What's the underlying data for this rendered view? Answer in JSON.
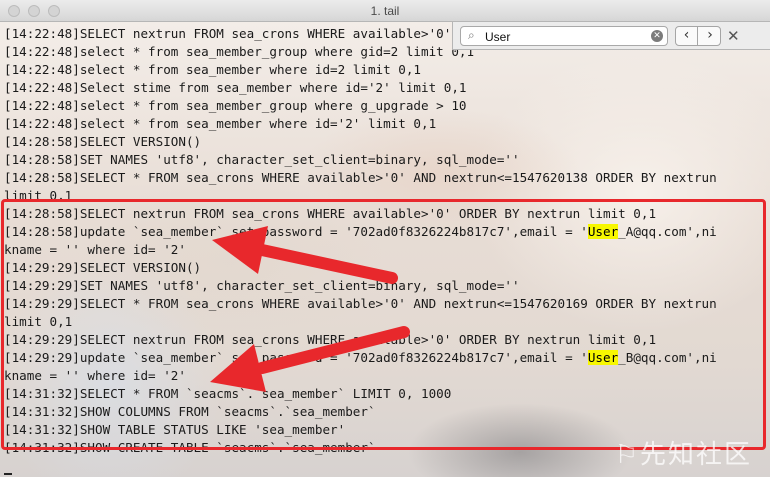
{
  "window": {
    "title": "1. tail"
  },
  "find_bar": {
    "query": "User",
    "clear_icon": "clear-icon",
    "prev_icon": "chevron-left-icon",
    "next_icon": "chevron-right-icon",
    "close_icon": "close-icon"
  },
  "highlight_color": "#e8282c",
  "terminal": {
    "lines": [
      "[14:22:48]SELECT nextrun FROM sea_crons WHERE available>'0' ORDER BY nextrun limit 0,1",
      "[14:22:48]select * from sea_member_group where gid=2 limit 0,1",
      "[14:22:48]select * from sea_member where id=2 limit 0,1",
      "[14:22:48]Select stime from sea_member where id='2' limit 0,1",
      "[14:22:48]select * from sea_member_group where g_upgrade > 10",
      "[14:22:48]select * from sea_member where id='2' limit 0,1",
      "[14:28:58]SELECT VERSION()",
      "[14:28:58]SET NAMES 'utf8', character_set_client=binary, sql_mode=''",
      "[14:28:58]SELECT * FROM sea_crons WHERE available>'0' AND nextrun<=1547620138 ORDER BY nextrun",
      "limit 0,1",
      "[14:28:58]SELECT nextrun FROM sea_crons WHERE available>'0' ORDER BY nextrun limit 0,1",
      [
        "[14:28:58]update `sea_member` set password = '702ad0f8326224b817c7',email = '",
        "User",
        "_A@qq.com',ni"
      ],
      "kname = '' where id= '2'",
      "[14:29:29]SELECT VERSION()",
      "[14:29:29]SET NAMES 'utf8', character_set_client=binary, sql_mode=''",
      "[14:29:29]SELECT * FROM sea_crons WHERE available>'0' AND nextrun<=1547620169 ORDER BY nextrun",
      "limit 0,1",
      "[14:29:29]SELECT nextrun FROM sea_crons WHERE available>'0' ORDER BY nextrun limit 0,1",
      [
        "[14:29:29]update `sea_member` set password = '702ad0f8326224b817c7',email = '",
        "User",
        "_B@qq.com',ni"
      ],
      "kname = '' where id= '2'",
      "[14:31:32]SELECT * FROM `seacms`.`sea_member` LIMIT 0, 1000",
      "[14:31:32]SHOW COLUMNS FROM `seacms`.`sea_member`",
      "[14:31:32]SHOW TABLE STATUS LIKE 'sea_member'",
      "[14:31:32]SHOW CREATE TABLE `seacms`.`sea_member`"
    ]
  }
}
